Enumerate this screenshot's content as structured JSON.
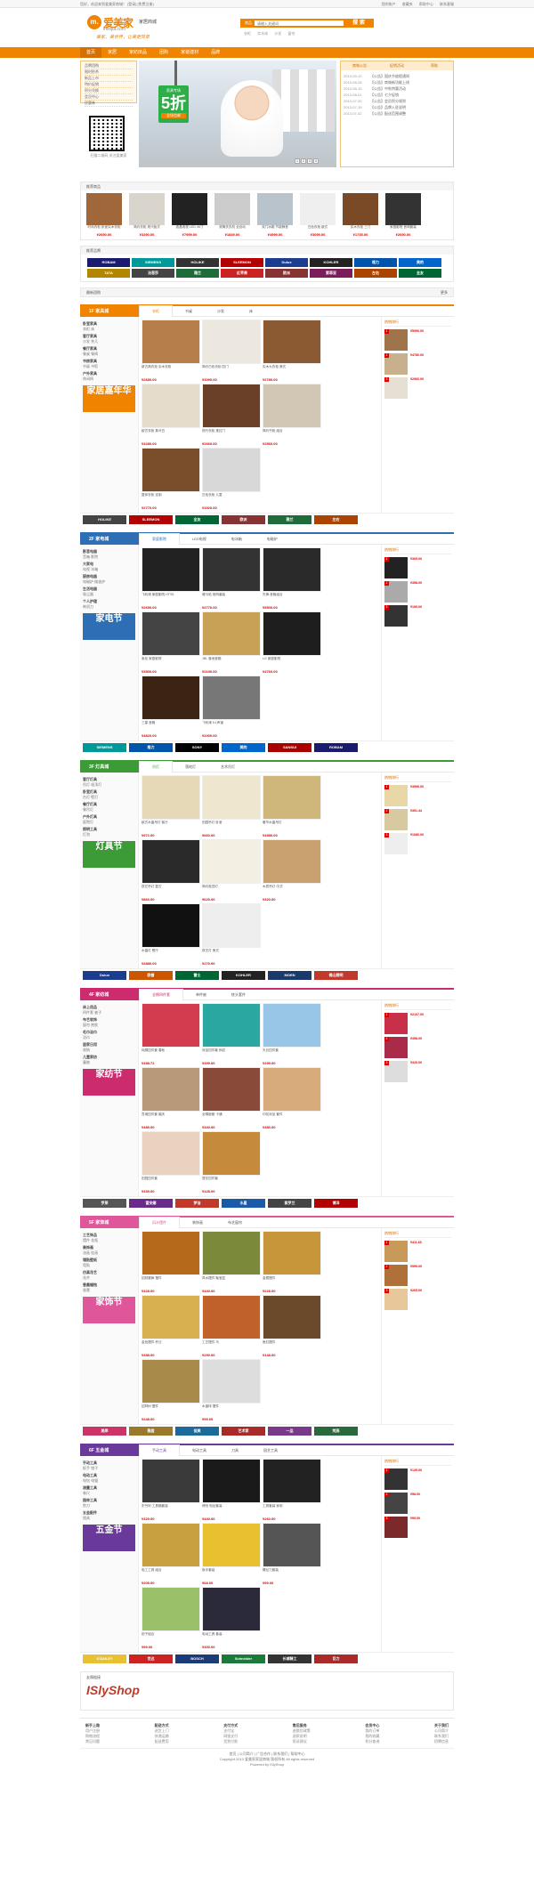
{
  "topbar": {
    "left": "您好，欢迎来到爱美家商城！ [登录] [免费注册]",
    "links": [
      "我的账户",
      "收藏夹",
      "帮助中心",
      "联系客服"
    ]
  },
  "logo": {
    "mark": "m.",
    "name": "爱美家",
    "tag": "家居商城",
    "domain": "imeijia.com",
    "slogan": "美家，美世界，让美更简单"
  },
  "search": {
    "cat": "商品",
    "placeholder": "请输入关键词",
    "button": "搜 索",
    "hot": [
      "衣柜",
      "实木床",
      "沙发",
      "窗帘"
    ]
  },
  "nav": [
    "首页",
    "家居",
    "家纺床品",
    "团购",
    "家装建材",
    "品牌"
  ],
  "leftcat": [
    "品牌团购",
    "限时秒杀",
    "新品上市",
    "特价促销",
    "积分兑换",
    "会员中心",
    "优惠券"
  ],
  "qrtext": "扫描二维码 关注爱美家",
  "banner": {
    "b1": "家具专场",
    "b2": "5折",
    "b3": "全场包邮",
    "pages": [
      "1",
      "2",
      "3",
      "4"
    ]
  },
  "rside": {
    "tabs": [
      "商城公告",
      "促销活动",
      "帮助"
    ],
    "news": [
      {
        "d": "2013-09-10",
        "t": "【公告】国庆节放假通知"
      },
      {
        "d": "2013-08-28",
        "t": "【公告】商城新功能上线"
      },
      {
        "d": "2013-08-15",
        "t": "【公告】中秋特惠活动"
      },
      {
        "d": "2013-08-01",
        "t": "【公告】七夕促销"
      },
      {
        "d": "2013-07-20",
        "t": "【公告】会员积分规则"
      },
      {
        "d": "2013-07-15",
        "t": "【公告】品牌入驻说明"
      },
      {
        "d": "2013-07-02",
        "t": "【公告】配送范围调整"
      }
    ]
  },
  "featured": {
    "title": "推荐商品",
    "items": [
      {
        "n": "时尚衣柜 卧室实木衣柜",
        "p": "¥2690.00",
        "c": "#a0683a"
      },
      {
        "n": "简约衣柜 现代板式",
        "p": "¥3290.00",
        "c": "#d9d5cc"
      },
      {
        "n": "液晶电视 LED 46寸",
        "p": "¥7999.00",
        "c": "#222"
      },
      {
        "n": "滚筒洗衣机 全自动",
        "p": "¥1849.00",
        "c": "#ccc"
      },
      {
        "n": "双门冰箱 节能静音",
        "p": "¥4999.00",
        "c": "#b8c3cc"
      },
      {
        "n": "白色衣柜 欧式",
        "p": "¥3099.00",
        "c": "#efefef"
      },
      {
        "n": "实木衣柜 三门",
        "p": "¥1735.00",
        "c": "#7a4a26"
      },
      {
        "n": "家庭影院 音响套装",
        "p": "¥2690.00",
        "c": "#333"
      }
    ]
  },
  "brands": {
    "title": "推荐品牌",
    "items": [
      [
        "ROBAM",
        "#1a1a6e"
      ],
      [
        "SIEMENS",
        "#009999"
      ],
      [
        "HOLIKE",
        "#333"
      ],
      [
        "SLEEMON",
        "#b30000"
      ],
      [
        "Dulux",
        "#1a3d8f"
      ],
      [
        "KOHLER",
        "#222"
      ],
      [
        "格力",
        "#0055aa"
      ],
      [
        "美的",
        "#0066cc"
      ],
      [
        "TATA",
        "#b38600"
      ],
      [
        "法恩莎",
        "#444"
      ],
      [
        "雅兰",
        "#1f6b3a"
      ],
      [
        "红苹果",
        "#cc2222"
      ],
      [
        "欧派",
        "#883333"
      ],
      [
        "索菲亚",
        "#7a1d5a"
      ],
      [
        "左右",
        "#aa4400"
      ],
      [
        "全友",
        "#006633"
      ]
    ]
  },
  "group": {
    "title": "最新团购",
    "more": "更多"
  },
  "floors": [
    {
      "label": "1F 家具城",
      "color": "#f08300",
      "tabs": [
        "衣柜",
        "书桌",
        "沙发",
        "床"
      ],
      "left": [
        [
          "卧室家具",
          "衣柜 床"
        ],
        [
          "客厅家具",
          "沙发 茶几"
        ],
        [
          "餐厅家具",
          "餐桌 餐椅"
        ],
        [
          "书房家具",
          "书桌 书柜"
        ],
        [
          "户外家具",
          "休闲椅"
        ]
      ],
      "promo": "家居嘉年华",
      "items": [
        [
          "新古典衣柜 实木衣柜",
          "¥2680.00",
          "#b57e4a"
        ],
        [
          "简约白色衣柜 四门",
          "¥3090.00",
          "#ece8e0"
        ],
        [
          "实木大衣柜 美式",
          "¥2780.00",
          "#8c5a32"
        ],
        [
          "欧式衣柜 象牙白",
          "¥3280.00",
          "#e6dccb"
        ],
        [
          "现代衣柜 推拉门",
          "¥2660.00",
          "#6a4028"
        ],
        [
          "简约书柜 组合",
          "¥2560.00",
          "#d2c7b5"
        ],
        [
          "整体衣柜 定制",
          "¥2770.00",
          "#7a4e2a"
        ],
        [
          "白色衣柜 儿童",
          "¥1920.00",
          "#d8d8d8"
        ]
      ],
      "right": [
        [
          "¥5990.00",
          "#a0744a"
        ],
        [
          "¥4780.00",
          "#c9b08c"
        ],
        [
          "¥2960.00",
          "#e6e0d4"
        ]
      ],
      "logos": [
        [
          "HOLIKE",
          "#444"
        ],
        [
          "SLEEMON",
          "#b30000"
        ],
        [
          "全友",
          "#006633"
        ],
        [
          "欧派",
          "#883333"
        ],
        [
          "雅兰",
          "#1f6b3a"
        ],
        [
          "左右",
          "#aa4400"
        ]
      ]
    },
    {
      "label": "2F 家电城",
      "color": "#2d6eb5",
      "tabs": [
        "家庭影院",
        "LED电视",
        "电冰箱",
        "电磁炉"
      ],
      "left": [
        [
          "影音电器",
          "音箱 影院"
        ],
        [
          "大家电",
          "电视 冰箱"
        ],
        [
          "厨房电器",
          "电磁炉 微波炉"
        ],
        [
          "生活电器",
          "吸尘器"
        ],
        [
          "个人护理",
          "剃须刀"
        ]
      ],
      "promo": "家电节",
      "items": [
        [
          "飞利浦 家庭影院 HTS5",
          "¥2690.00",
          "#222"
        ],
        [
          "雅马哈 音响套装",
          "¥2770.00",
          "#333"
        ],
        [
          "先锋 音箱组合",
          "¥5500.00",
          "#2a2a2a"
        ],
        [
          "索尼 家庭影院",
          "¥3500.00",
          "#444"
        ],
        [
          "JBL 落地音箱",
          "¥2190.00",
          "#c8a056"
        ],
        [
          "LG 家庭影院",
          "¥4760.00",
          "#1e1e1e"
        ],
        [
          "三星 音箱",
          "¥4820.00",
          "#3b2414"
        ],
        [
          "飞利浦 5.1声道",
          "¥2000.00",
          "#777"
        ]
      ],
      "right": [
        [
          "¥369.00",
          "#222"
        ],
        [
          "¥358.00",
          "#aaa"
        ],
        [
          "¥199.00",
          "#333"
        ]
      ],
      "logos": [
        [
          "SIEMENS",
          "#009999"
        ],
        [
          "格力",
          "#0055aa"
        ],
        [
          "SONY",
          "#000"
        ],
        [
          "美的",
          "#0066cc"
        ],
        [
          "SANSUI",
          "#aa0000"
        ],
        [
          "ROBAM",
          "#1a1a6e"
        ]
      ]
    },
    {
      "label": "3F 灯具城",
      "color": "#3c9a37",
      "tabs": [
        "吊灯",
        "落地灯",
        "艺术吊灯"
      ],
      "left": [
        [
          "客厅灯具",
          "吊灯 吸顶灯"
        ],
        [
          "卧室灯具",
          "台灯 壁灯"
        ],
        [
          "餐厅灯具",
          "餐吊灯"
        ],
        [
          "户外灯具",
          "庭院灯"
        ],
        [
          "照明工具",
          "灯泡"
        ]
      ],
      "promo": "灯具节",
      "items": [
        [
          "欧式水晶吊灯 客厅",
          "¥972.00",
          "#e6d9b8"
        ],
        [
          "田园吊灯 卧室",
          "¥660.00",
          "#efe6d0"
        ],
        [
          "奢华水晶吊灯",
          "¥4980.00",
          "#cfb77c"
        ],
        [
          "铁艺吊灯 复古",
          "¥860.00",
          "#2a2a2a"
        ],
        [
          "简约吸顶灯",
          "¥620.00",
          "#f4efe3"
        ],
        [
          "木质吊灯 中式",
          "¥320.00",
          "#c9a070"
        ],
        [
          "水晶灯 餐厅",
          "¥2880.00",
          "#111"
        ],
        [
          "铁艺灯 美式",
          "¥270.00",
          "#eee"
        ]
      ],
      "right": [
        [
          "¥3999.00",
          "#e8d8a8"
        ],
        [
          "¥391.44",
          "#d8c9a0"
        ],
        [
          "¥1080.00",
          "#eee"
        ]
      ],
      "logos": [
        [
          "Dulux",
          "#1a3d8f"
        ],
        [
          "欧普",
          "#cc5500"
        ],
        [
          "雷士",
          "#006633"
        ],
        [
          "KOHLER",
          "#222"
        ],
        [
          "MOEN",
          "#1a3a6e"
        ],
        [
          "佛山照明",
          "#c0392b"
        ]
      ]
    },
    {
      "label": "4F 家纺城",
      "color": "#cc2b6e",
      "tabs": [
        "全棉四件套",
        "单件被",
        "枕头套件"
      ],
      "left": [
        [
          "床上用品",
          "四件套 被子"
        ],
        [
          "布艺软饰",
          "窗帘 抱枕"
        ],
        [
          "毛巾浴巾",
          "浴巾"
        ],
        [
          "居家日用",
          "收纳"
        ],
        [
          "儿童家纺",
          "童被"
        ]
      ],
      "promo": "家纺节",
      "items": [
        [
          "纯棉四件套 春秋",
          "¥398.72",
          "#d23c4e"
        ],
        [
          "床品四件套 斜纹",
          "¥399.00",
          "#2aa7a0"
        ],
        [
          "天丝四件套",
          "¥299.00",
          "#98c6e6"
        ],
        [
          "贡缎四件套 婚庆",
          "¥489.00",
          "#b89a7a"
        ],
        [
          "全棉被套 卡通",
          "¥340.00",
          "#8a4a3a"
        ],
        [
          "印花床品 套件",
          "¥380.00",
          "#d7ab7a"
        ],
        [
          "田园四件套",
          "¥339.00",
          "#ead2c0"
        ],
        [
          "提花四件套",
          "¥128.00",
          "#c68a3c"
        ]
      ],
      "right": [
        [
          "¥2107.00",
          "#c8304a"
        ],
        [
          "¥358.00",
          "#aa2a4a"
        ],
        [
          "¥320.00",
          "#ddd"
        ]
      ],
      "logos": [
        [
          "罗莱",
          "#555"
        ],
        [
          "富安娜",
          "#6a2a8a"
        ],
        [
          "梦洁",
          "#c0392b"
        ],
        [
          "水星",
          "#1a5aa8"
        ],
        [
          "紫罗兰",
          "#444"
        ],
        [
          "博洋",
          "#b30000"
        ]
      ]
    },
    {
      "label": "5F 家饰城",
      "color": "#e0569b",
      "tabs": [
        "风水摆件",
        "装饰画",
        "布艺窗帘"
      ],
      "left": [
        [
          "工艺饰品",
          "摆件 花瓶"
        ],
        [
          "装饰画",
          "油画 挂画"
        ],
        [
          "墙贴壁纸",
          "墙贴"
        ],
        [
          "仿真花艺",
          "花卉"
        ],
        [
          "香薰蜡烛",
          "香薰"
        ]
      ],
      "promo": "家饰节",
      "items": [
        [
          "招财貔貅 摆件",
          "¥328.00",
          "#b46a1a"
        ],
        [
          "风水摆件 聚宝盆",
          "¥440.00",
          "#7a8a3a"
        ],
        [
          "金蟾摆件",
          "¥228.00",
          "#c8963a"
        ],
        [
          "金色摆件 乔迁",
          "¥358.00",
          "#d8b050"
        ],
        [
          "工艺摆件 马",
          "¥290.00",
          "#c0602a"
        ],
        [
          "鱼缸摆件",
          "¥148.00",
          "#6a4a2a"
        ],
        [
          "招财树 摆件",
          "¥248.00",
          "#a88a4a"
        ],
        [
          "水晶球 摆件",
          "¥99.00",
          "#ddd"
        ]
      ],
      "right": [
        [
          "¥411.60",
          "#c89a5a"
        ],
        [
          "¥599.00",
          "#b0703a"
        ],
        [
          "¥265.00",
          "#e8c89a"
        ]
      ],
      "logos": [
        [
          "美岸",
          "#cc3366"
        ],
        [
          "雅居",
          "#9a7a2a"
        ],
        [
          "佳美",
          "#1a6a9a"
        ],
        [
          "艺术家",
          "#aa2a2a"
        ],
        [
          "一品",
          "#7a3a8a"
        ],
        [
          "梵高",
          "#2a6a3a"
        ]
      ]
    },
    {
      "label": "6F 五金城",
      "color": "#6a3a9a",
      "tabs": [
        "手动工具",
        "电动工具",
        "刀具",
        "园艺工具"
      ],
      "left": [
        [
          "手动工具",
          "扳手 钳子"
        ],
        [
          "电动工具",
          "电钻 电锯"
        ],
        [
          "测量工具",
          "卷尺"
        ],
        [
          "园林工具",
          "剪刀"
        ],
        [
          "五金配件",
          "锁具"
        ]
      ],
      "promo": "五金节",
      "items": [
        [
          "史丹利 工具箱套装",
          "¥329.00",
          "#3a3a3a"
        ],
        [
          "博世 电钻套装",
          "¥440.00",
          "#1a1a1a"
        ],
        [
          "工具套装 家用",
          "¥260.00",
          "#222"
        ],
        [
          "电工工具 组合",
          "¥209.00",
          "#c8a040"
        ],
        [
          "扳手套装",
          "¥68.00",
          "#e8c030"
        ],
        [
          "螺丝刀套装",
          "¥99.00",
          "#555"
        ],
        [
          "钳子组合",
          "¥99.00",
          "#9ac06a"
        ],
        [
          "电动工具 套装",
          "¥300.00",
          "#2a2a3a"
        ]
      ],
      "right": [
        [
          "¥139.00",
          "#333"
        ],
        [
          "¥58.00",
          "#444"
        ],
        [
          "¥99.00",
          "#7a2a2a"
        ]
      ],
      "logos": [
        [
          "STANLEY",
          "#e8c030"
        ],
        [
          "世达",
          "#cc2222"
        ],
        [
          "BOSCH",
          "#1a3a7a"
        ],
        [
          "Schneider",
          "#1a7a3a"
        ],
        [
          "长城精工",
          "#333"
        ],
        [
          "巨力",
          "#aa2a2a"
        ]
      ]
    }
  ],
  "linksbar": {
    "title": "友情链接",
    "logo": "ISlyShop"
  },
  "footer": {
    "cols": [
      [
        "新手上路",
        [
          "用户注册",
          "购物流程",
          "常见问题"
        ]
      ],
      [
        "配送方式",
        [
          "送货上门",
          "快递运输",
          "配送费用"
        ]
      ],
      [
        "支付方式",
        [
          "支付宝",
          "网银支付",
          "货到付款"
        ]
      ],
      [
        "售后服务",
        [
          "退换货政策",
          "退款说明",
          "投诉建议"
        ]
      ],
      [
        "会员中心",
        [
          "我的订单",
          "我的收藏",
          "积分查询"
        ]
      ],
      [
        "关于我们",
        [
          "公司简介",
          "联系我们",
          "招聘信息"
        ]
      ]
    ],
    "bar": "首页 | 公司简介 | 广告合作 | 联系我们 | 帮助中心",
    "copy": "Copyright 2013 爱美家家居商城 版权所有 All rights reserved",
    "power": "Powered by ISlyShop"
  }
}
